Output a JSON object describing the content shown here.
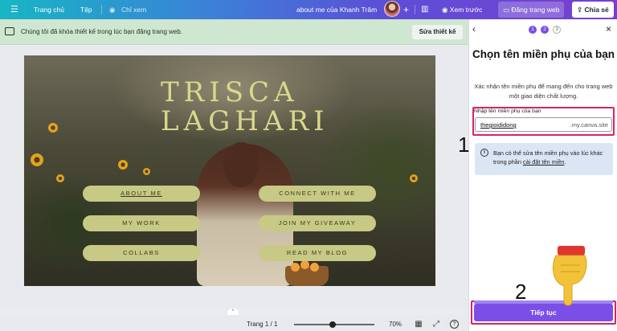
{
  "topbar": {
    "menu_icon": "hamburger-icon",
    "home": "Trang chủ",
    "file": "Tệp",
    "view_mode": "Chỉ xem",
    "view_icon": "eye-icon",
    "doc_title": "about me của Khanh Trâm",
    "add_icon": "plus-icon",
    "stats_icon": "bar-chart-icon",
    "preview": "Xem trước",
    "preview_icon": "eye-icon",
    "publish": "Đăng trang web",
    "publish_icon": "monitor-icon",
    "share": "Chia sẻ",
    "share_icon": "upload-icon"
  },
  "notice": {
    "icon": "keyboard-icon",
    "text": "Chúng tôi đã khóa thiết kế trong lúc bạn đăng trang web.",
    "button": "Sửa thiết kế"
  },
  "design": {
    "logo_line1": "TRISCA",
    "logo_line2": "LAGHARI",
    "buttons_left": [
      "ABOUT ME",
      "MY WORK",
      "COLLABS"
    ],
    "buttons_right": [
      "CONNECT WITH ME",
      "JOIN MY GIVEAWAY",
      "READ MY BLOG"
    ]
  },
  "bottombar": {
    "page": "Trang 1 / 1",
    "zoom": "70%",
    "zoom_level": 0.48,
    "icons": [
      "grid-icon",
      "fullscreen-icon",
      "help-icon"
    ]
  },
  "panel": {
    "back_icon": "chevron-left-icon",
    "close_icon": "close-icon",
    "steps": [
      "1",
      "2",
      "3"
    ],
    "current_step": 2,
    "title": "Chọn tên miền phụ của bạn",
    "subtitle": "Xác nhận tên miền phụ để mang đến cho trang web một giao diện chất lượng.",
    "field_label": "Nhập tên miền phụ của bạn",
    "field_value": "thegioididong",
    "field_suffix": ".my.canva.site",
    "info_icon": "info-icon",
    "info_text": "Bạn có thể sửa tên miền phụ vào lúc khác trong phần ",
    "info_link": "cài đặt tên miền",
    "info_end": ".",
    "cta": "Tiếp tục"
  },
  "annotations": {
    "step1": "1",
    "step2": "2",
    "hand_icon": "pointing-hand-icon"
  },
  "colors": {
    "accent": "#7b4ee8",
    "highlight": "#d6236a",
    "notice_bg": "#cfe6d0",
    "pill": "#c7c985"
  }
}
